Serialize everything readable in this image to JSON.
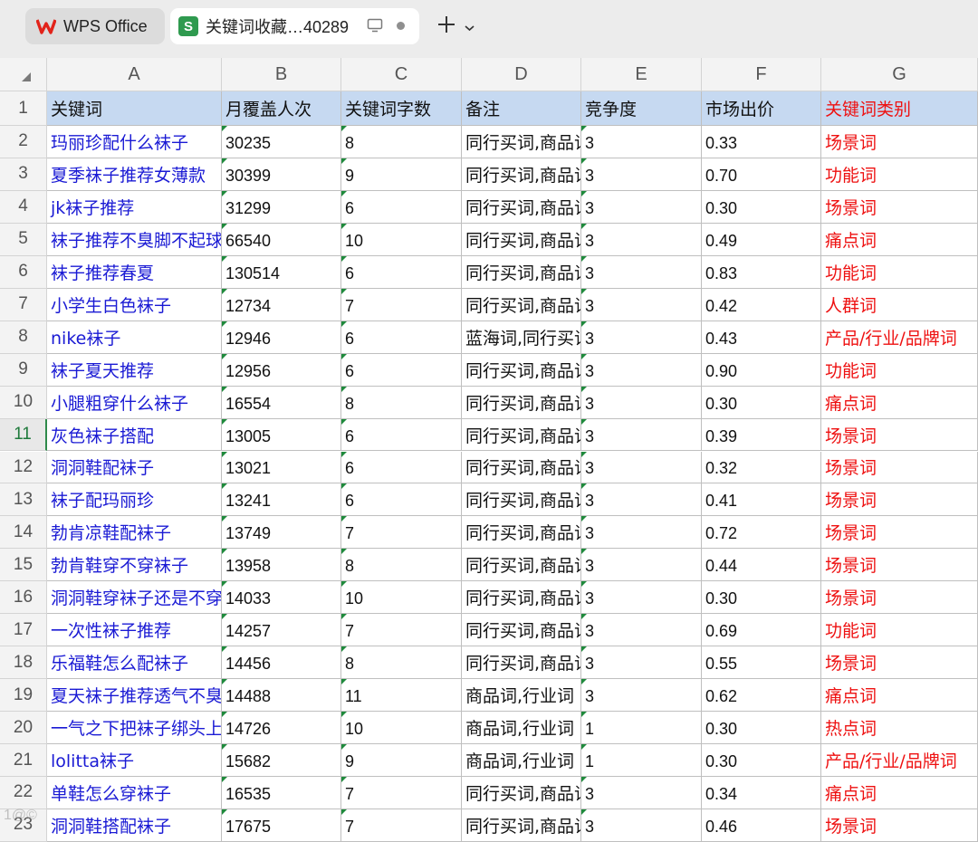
{
  "tabs": {
    "wps": {
      "label": "WPS Office",
      "icon": "wps-logo-icon"
    },
    "doc": {
      "label": "关键词收藏…40289",
      "icon": "spreadsheet-s-icon",
      "badge": "S"
    }
  },
  "sheet": {
    "columns": [
      "A",
      "B",
      "C",
      "D",
      "E",
      "F",
      "G"
    ],
    "active_row": 11,
    "header": [
      "关键词",
      "月覆盖人次",
      "关键词字数",
      "备注",
      "竞争度",
      "市场出价",
      "关键词类别"
    ],
    "rows": [
      [
        "玛丽珍配什么袜子",
        "30235",
        "8",
        "同行买词,商品词",
        "3",
        "0.33",
        "场景词"
      ],
      [
        "夏季袜子推荐女薄款",
        "30399",
        "9",
        "同行买词,商品词",
        "3",
        "0.70",
        "功能词"
      ],
      [
        "jk袜子推荐",
        "31299",
        "6",
        "同行买词,商品词",
        "3",
        "0.30",
        "场景词"
      ],
      [
        "袜子推荐不臭脚不起球",
        "66540",
        "10",
        "同行买词,商品词",
        "3",
        "0.49",
        "痛点词"
      ],
      [
        "袜子推荐春夏",
        "130514",
        "6",
        "同行买词,商品词",
        "3",
        "0.83",
        "功能词"
      ],
      [
        "小学生白色袜子",
        "12734",
        "7",
        "同行买词,商品词",
        "3",
        "0.42",
        "人群词"
      ],
      [
        "nike袜子",
        "12946",
        "6",
        "蓝海词,同行买词",
        "3",
        "0.43",
        "产品/行业/品牌词"
      ],
      [
        "袜子夏天推荐",
        "12956",
        "6",
        "同行买词,商品词",
        "3",
        "0.90",
        "功能词"
      ],
      [
        "小腿粗穿什么袜子",
        "16554",
        "8",
        "同行买词,商品词",
        "3",
        "0.30",
        "痛点词"
      ],
      [
        "灰色袜子搭配",
        "13005",
        "6",
        "同行买词,商品词",
        "3",
        "0.39",
        "场景词"
      ],
      [
        "洞洞鞋配袜子",
        "13021",
        "6",
        "同行买词,商品词",
        "3",
        "0.32",
        "场景词"
      ],
      [
        "袜子配玛丽珍",
        "13241",
        "6",
        "同行买词,商品词",
        "3",
        "0.41",
        "场景词"
      ],
      [
        "勃肯凉鞋配袜子",
        "13749",
        "7",
        "同行买词,商品词",
        "3",
        "0.72",
        "场景词"
      ],
      [
        "勃肯鞋穿不穿袜子",
        "13958",
        "8",
        "同行买词,商品词",
        "3",
        "0.44",
        "场景词"
      ],
      [
        "洞洞鞋穿袜子还是不穿",
        "14033",
        "10",
        "同行买词,商品词",
        "3",
        "0.30",
        "场景词"
      ],
      [
        "一次性袜子推荐",
        "14257",
        "7",
        "同行买词,商品词",
        "3",
        "0.69",
        "功能词"
      ],
      [
        "乐福鞋怎么配袜子",
        "14456",
        "8",
        "同行买词,商品词",
        "3",
        "0.55",
        "场景词"
      ],
      [
        "夏天袜子推荐透气不臭脚",
        "14488",
        "11",
        "商品词,行业词",
        "3",
        "0.62",
        "痛点词"
      ],
      [
        "一气之下把袜子绑头上",
        "14726",
        "10",
        "商品词,行业词",
        "1",
        "0.30",
        "热点词"
      ],
      [
        "lolitta袜子",
        "15682",
        "9",
        "商品词,行业词",
        "1",
        "0.30",
        "产品/行业/品牌词"
      ],
      [
        "单鞋怎么穿袜子",
        "16535",
        "7",
        "同行买词,商品词",
        "3",
        "0.34",
        "痛点词"
      ],
      [
        "洞洞鞋搭配袜子",
        "17675",
        "7",
        "同行买词,商品词",
        "3",
        "0.46",
        "场景词"
      ]
    ]
  },
  "colors": {
    "header_fill": "#c6d9f1",
    "keyword_text": "#1a1ad4",
    "category_text": "#ee1111",
    "active_row": "#1f7a3c"
  }
}
